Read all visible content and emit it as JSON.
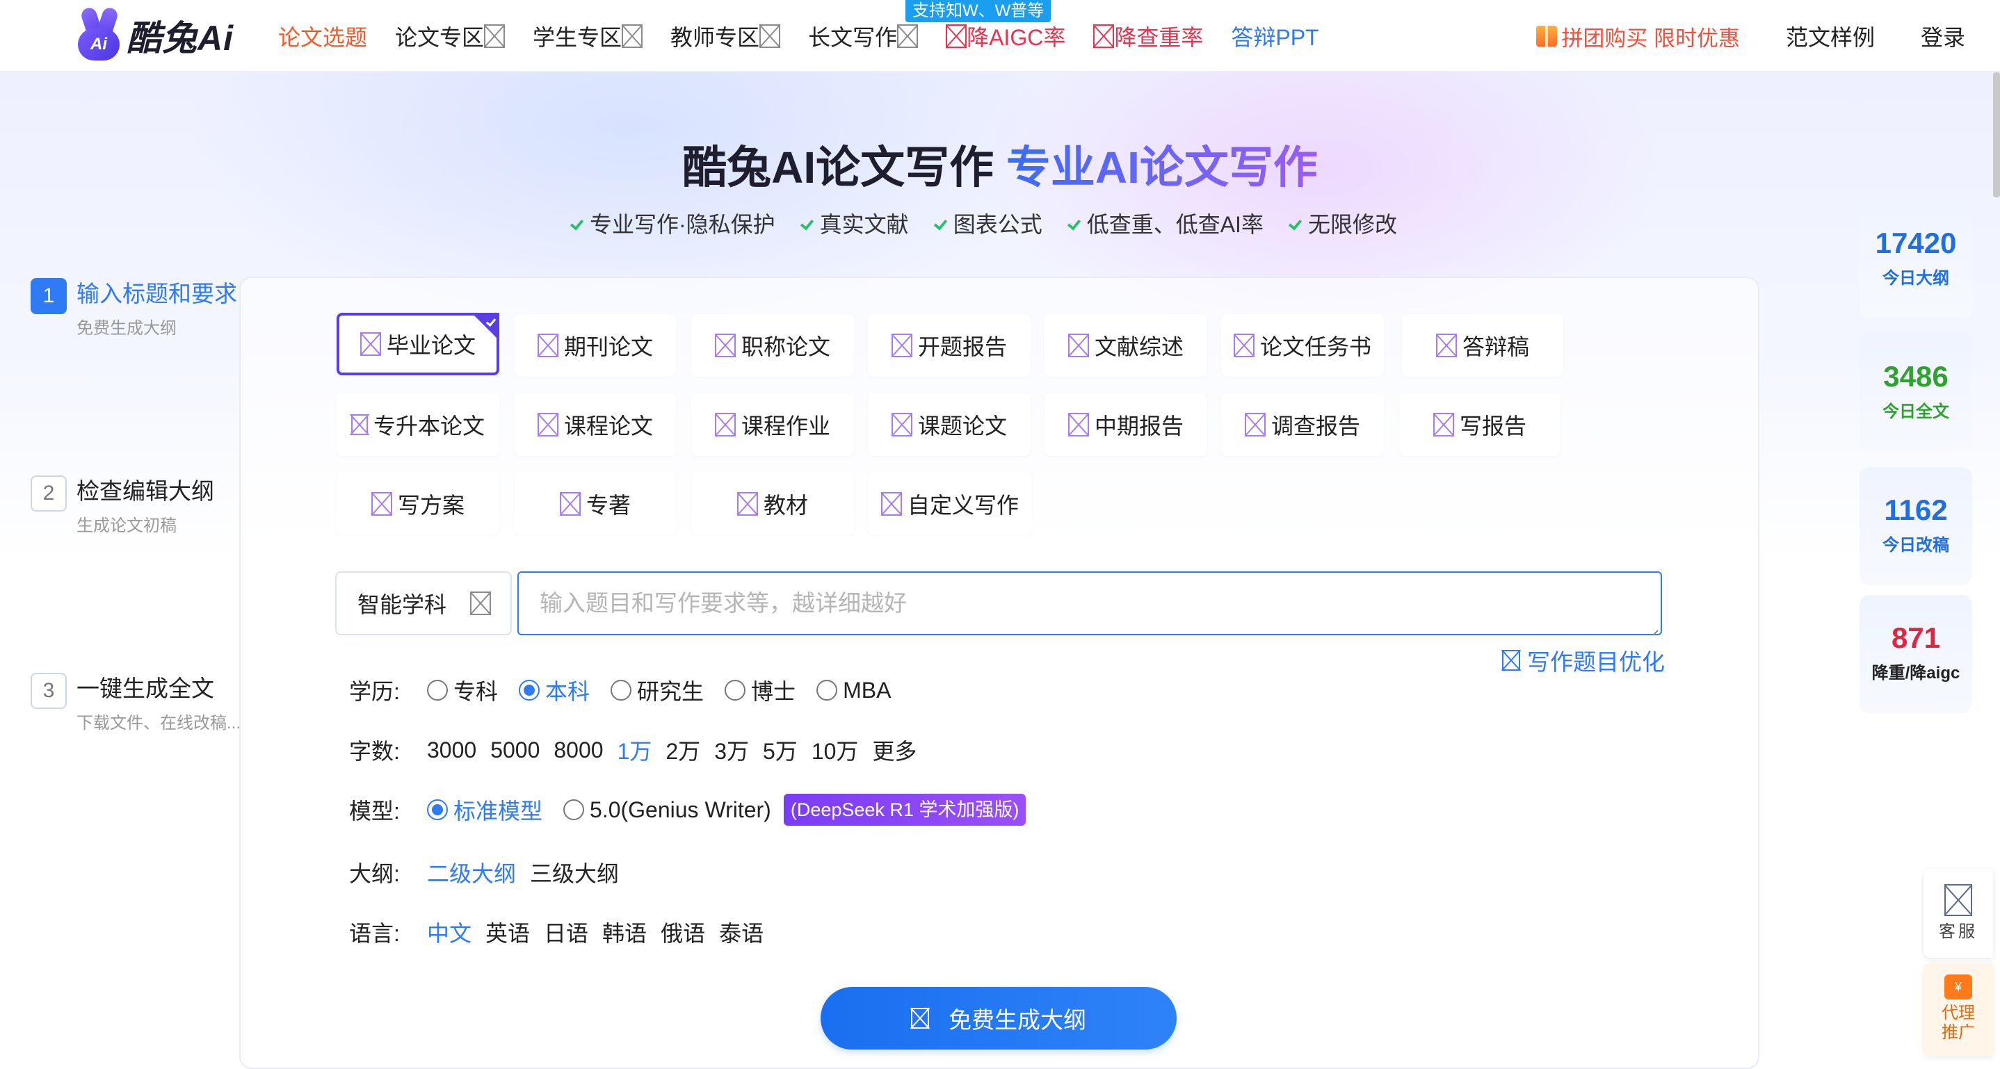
{
  "brand": {
    "name": "酷兔Ai",
    "mark": "Ai"
  },
  "nav": {
    "items": [
      {
        "label": "论文选题",
        "style": "active",
        "icon": false
      },
      {
        "label": "论文专区",
        "style": "normal",
        "icon": true
      },
      {
        "label": "学生专区",
        "style": "normal",
        "icon": true
      },
      {
        "label": "教师专区",
        "style": "normal",
        "icon": true
      },
      {
        "label": "长文写作",
        "style": "normal",
        "icon": true
      },
      {
        "label": "降AIGC率",
        "style": "red",
        "icon": true
      },
      {
        "label": "降查重率",
        "style": "red",
        "icon": true
      },
      {
        "label": "答辩PPT",
        "style": "blue",
        "icon": false
      }
    ],
    "badge": "支持知W、W普等",
    "promo": "拼团购买 限时优惠",
    "samples": "范文样例",
    "login": "登录"
  },
  "hero": {
    "title_main": "酷兔AI论文写作",
    "title_accent": "专业AI论文写作",
    "features": [
      "专业写作·隐私保护",
      "真实文献",
      "图表公式",
      "低查重、低查AI率",
      "无限修改"
    ]
  },
  "steps": [
    {
      "num": "1",
      "title": "输入标题和要求",
      "sub": "免费生成大纲"
    },
    {
      "num": "2",
      "title": "检查编辑大纲",
      "sub": "生成论文初稿"
    },
    {
      "num": "3",
      "title": "一键生成全文",
      "sub": "下载文件、在线改稿..."
    }
  ],
  "types": {
    "row1": [
      "毕业论文",
      "期刊论文",
      "职称论文",
      "开题报告",
      "文献综述",
      "论文任务书",
      "答辩稿"
    ],
    "row2": [
      "专升本论文",
      "课程论文",
      "课程作业",
      "课题论文",
      "中期报告",
      "调查报告",
      "写报告"
    ],
    "row3": [
      "写方案",
      "专著",
      "教材",
      "自定义写作"
    ],
    "selected": "毕业论文"
  },
  "input": {
    "subject": "智能学科",
    "placeholder": "输入题目和写作要求等，越详细越好",
    "optimize": "写作题目优化"
  },
  "options": {
    "education": {
      "label": "学历:",
      "choices": [
        "专科",
        "本科",
        "研究生",
        "博士",
        "MBA"
      ],
      "selected": "本科"
    },
    "words": {
      "label": "字数:",
      "choices": [
        "3000",
        "5000",
        "8000",
        "1万",
        "2万",
        "3万",
        "5万",
        "10万",
        "更多"
      ],
      "selected": "1万"
    },
    "model": {
      "label": "模型:",
      "choices": [
        "标准模型",
        "5.0(Genius Writer)"
      ],
      "selected": "标准模型",
      "badge": "(DeepSeek R1 学术加强版)"
    },
    "outline": {
      "label": "大纲:",
      "choices": [
        "二级大纲",
        "三级大纲"
      ],
      "selected": "二级大纲"
    },
    "language": {
      "label": "语言:",
      "choices": [
        "中文",
        "英语",
        "日语",
        "韩语",
        "俄语",
        "泰语"
      ],
      "selected": "中文"
    }
  },
  "generate_button": "免费生成大纲",
  "stats": [
    {
      "value": "17420",
      "label": "今日大纲",
      "color": "#1f6fe3"
    },
    {
      "value": "3486",
      "label": "今日全文",
      "color": "#2fa12e"
    },
    {
      "value": "1162",
      "label": "今日改稿",
      "color": "#1f6fe3"
    },
    {
      "value": "871",
      "label": "降重/降aigc",
      "color": "#e0263e"
    }
  ],
  "side": {
    "service": "客服",
    "agent_line1": "代理",
    "agent_line2": "推广",
    "agent_icon": "¥"
  }
}
